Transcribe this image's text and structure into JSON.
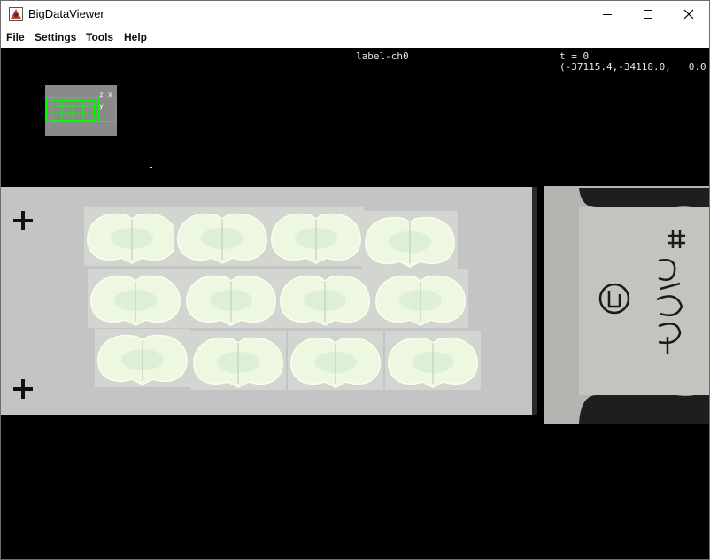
{
  "window": {
    "title": "BigDataViewer",
    "icons": {
      "app": "bigdataviewer-app-icon",
      "minimize": "minimize-icon",
      "maximize": "maximize-icon",
      "close": "close-icon"
    }
  },
  "menu": {
    "items": [
      "File",
      "Settings",
      "Tools",
      "Help"
    ]
  },
  "viewer": {
    "source_name": "label-ch0",
    "timepoint": "t = 0",
    "coordinates": "(-37115.4,-34118.0,   0.0",
    "navigator": {
      "axis_z": "z",
      "axis_x": "x",
      "axis_y": "y"
    }
  },
  "colors": {
    "viewer_background": "#000000",
    "navigator_box": "#00ff00",
    "tissue": "#eef7df"
  }
}
